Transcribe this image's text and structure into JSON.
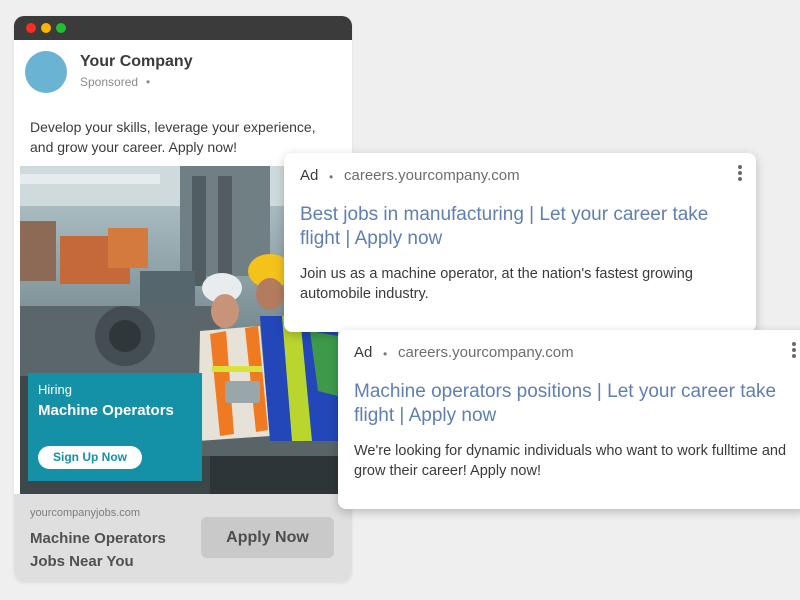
{
  "social_ad": {
    "company_name": "Your Company",
    "sponsored_label": "Sponsored",
    "bullet": "•",
    "post_text": "Develop your skills, leverage your experience, and grow your career. Apply now!",
    "image": {
      "hiring_label": "Hiring",
      "hiring_title": "Machine Operators",
      "cta_label": "Sign Up Now",
      "accent_color": "#1491a6"
    },
    "footer": {
      "url": "yourcompanyjobs.com",
      "headline": "Machine Operators Jobs Near You",
      "button_label": "Apply Now"
    }
  },
  "search_ads": [
    {
      "ad_label": "Ad",
      "separator": "•",
      "url": "careers.yourcompany.com",
      "headline": "Best jobs in manufacturing | Let your career take flight | Apply now",
      "description": "Join us as a machine operator, at the nation's fastest growing automobile industry."
    },
    {
      "ad_label": "Ad",
      "separator": "•",
      "url": "careers.yourcompany.com",
      "headline": "Machine operators positions | Let your career take flight | Apply now",
      "description": "We're looking for dynamic individuals who want to work fulltime and grow their career! Apply now!"
    }
  ],
  "colors": {
    "link_blue": "#5f7fb3",
    "avatar": "#6ab3d3",
    "titlebar": "#3b3b3b"
  }
}
